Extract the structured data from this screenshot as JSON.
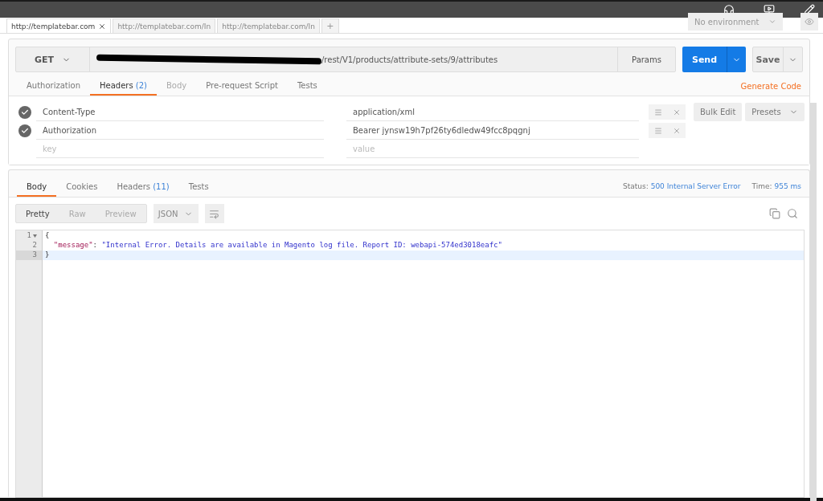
{
  "tabs": [
    {
      "label": "http://templatebar.com",
      "selected": true
    },
    {
      "label": "http://templatebar.com/In",
      "selected": false
    },
    {
      "label": "http://templatebar.com/In",
      "selected": false
    }
  ],
  "new_tab": "+",
  "environment": {
    "label": "No environment"
  },
  "request": {
    "method": "GET",
    "url": "/rest/V1/products/attribute-sets/9/attributes",
    "params": "Params",
    "send": "Send",
    "save": "Save"
  },
  "request_tabs": [
    {
      "label": "Authorization",
      "selected": false,
      "disabled": false
    },
    {
      "label": "Headers",
      "count": "(2)",
      "selected": true,
      "disabled": false
    },
    {
      "label": "Body",
      "selected": false,
      "disabled": true
    },
    {
      "label": "Pre-request Script",
      "selected": false,
      "disabled": false
    },
    {
      "label": "Tests",
      "selected": false,
      "disabled": false
    }
  ],
  "generate_code": "Generate Code",
  "headers": [
    {
      "key": "Content-Type",
      "value": "application/xml",
      "checked": true
    },
    {
      "key": "Authorization",
      "value": "Bearer jynsw19h7pf26ty6dledw49fcc8pqgnj",
      "checked": true
    }
  ],
  "new_header": {
    "key_placeholder": "key",
    "value_placeholder": "value"
  },
  "bulk_edit": "Bulk Edit",
  "presets": "Presets",
  "response_tabs": [
    {
      "label": "Body",
      "selected": true
    },
    {
      "label": "Cookies",
      "selected": false
    },
    {
      "label": "Headers",
      "count": "(11)",
      "selected": false
    },
    {
      "label": "Tests",
      "selected": false
    }
  ],
  "status": {
    "label": "Status:",
    "value": "500 Internal Server Error"
  },
  "time": {
    "label": "Time:",
    "value": "955 ms"
  },
  "view_modes": [
    {
      "label": "Pretty",
      "selected": true
    },
    {
      "label": "Raw",
      "selected": false
    },
    {
      "label": "Preview",
      "selected": false
    }
  ],
  "format": "JSON",
  "code": [
    {
      "number": "1",
      "foldable": true,
      "highlighted": false,
      "tokens": [
        {
          "kind": "punct",
          "text": "{"
        }
      ]
    },
    {
      "number": "2",
      "foldable": false,
      "highlighted": false,
      "tokens": [
        {
          "kind": "key",
          "text": "  \"message\""
        },
        {
          "kind": "punct",
          "text": ": "
        },
        {
          "kind": "string",
          "text": "\"Internal Error. Details are available in Magento log file. Report ID: webapi-574ed3018eafc\""
        }
      ]
    },
    {
      "number": "3",
      "foldable": false,
      "highlighted": true,
      "tokens": [
        {
          "kind": "punct",
          "text": "}"
        }
      ]
    }
  ]
}
